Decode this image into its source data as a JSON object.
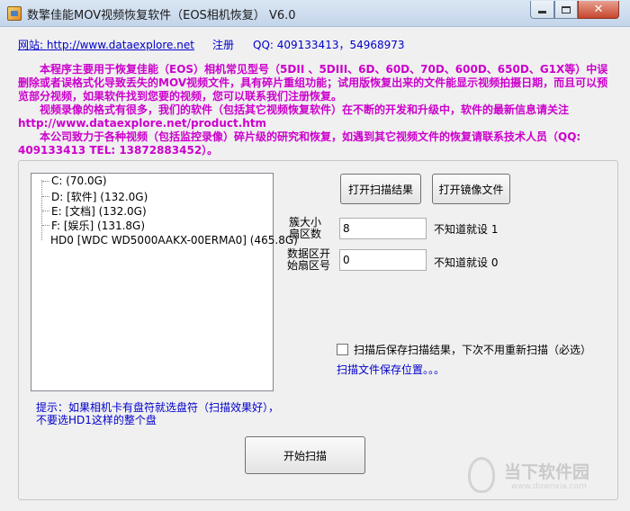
{
  "window": {
    "title": "数擎佳能MOV视频恢复软件（EOS相机恢复） V6.0",
    "min_label": "",
    "max_label": "",
    "close_label": "✕"
  },
  "header": {
    "site_label": "网站: ",
    "site_url": "http://www.dataexplore.net",
    "register_label": "注册",
    "qq_text": "QQ: 409133413，54968973"
  },
  "intro": {
    "paragraphs": [
      "本程序主要用于恢复佳能（EOS）相机常见型号（5DII 、5DIII、6D、60D、70D、600D、650D、G1X等）中误删除或者误格式化导致丢失的MOV视频文件，具有碎片重组功能；试用版恢复出来的文件能显示视频拍摄日期，而且可以预览部分视频，如果软件找到您要的视频，您可以联系我们注册恢复。",
      "视频录像的格式有很多，我们的软件（包括其它视频恢复软件）在不断的开发和升级中，软件的最新信息请关注 http://www.dataexplore.net/product.htm",
      "本公司致力于各种视频（包括监控录像）碎片级的研究和恢复，如遇到其它视频文件的恢复请联系技术人员（QQ: 409133413 TEL: 13872883452）。"
    ]
  },
  "drives": [
    {
      "label": "C:   (70.0G)"
    },
    {
      "label": "D:   [软件]  (132.0G)"
    },
    {
      "label": "E:   [文档]  (132.0G)"
    },
    {
      "label": "F:   [娱乐]  (131.8G)"
    },
    {
      "label": "HD0   [WDC WD5000AAKX-00ERMA0]  (465.8G)"
    }
  ],
  "buttons": {
    "open_scan": "打开扫描结果",
    "open_image": "打开镜像文件",
    "start_scan": "开始扫描"
  },
  "params": {
    "cluster_label_1": "簇大小",
    "cluster_label_2": "扇区数",
    "cluster_value": "8",
    "cluster_hint": "不知道就设 1",
    "start_label_1": "数据区开",
    "start_label_2": "始扇区号",
    "start_value": "0",
    "start_hint": "不知道就设 0"
  },
  "options": {
    "save_checkbox_label": "扫描后保存扫描结果，下次不用重新扫描（必选）",
    "save_checked": false,
    "save_location_link": "扫描文件保存位置。。。"
  },
  "tip": {
    "line1": "提示：如果相机卡有盘符就选盘符（扫描效果好），",
    "line2": "不要选HD1这样的整个盘"
  },
  "watermark": {
    "text": "当下软件园",
    "sub": "www.downxia.com"
  }
}
